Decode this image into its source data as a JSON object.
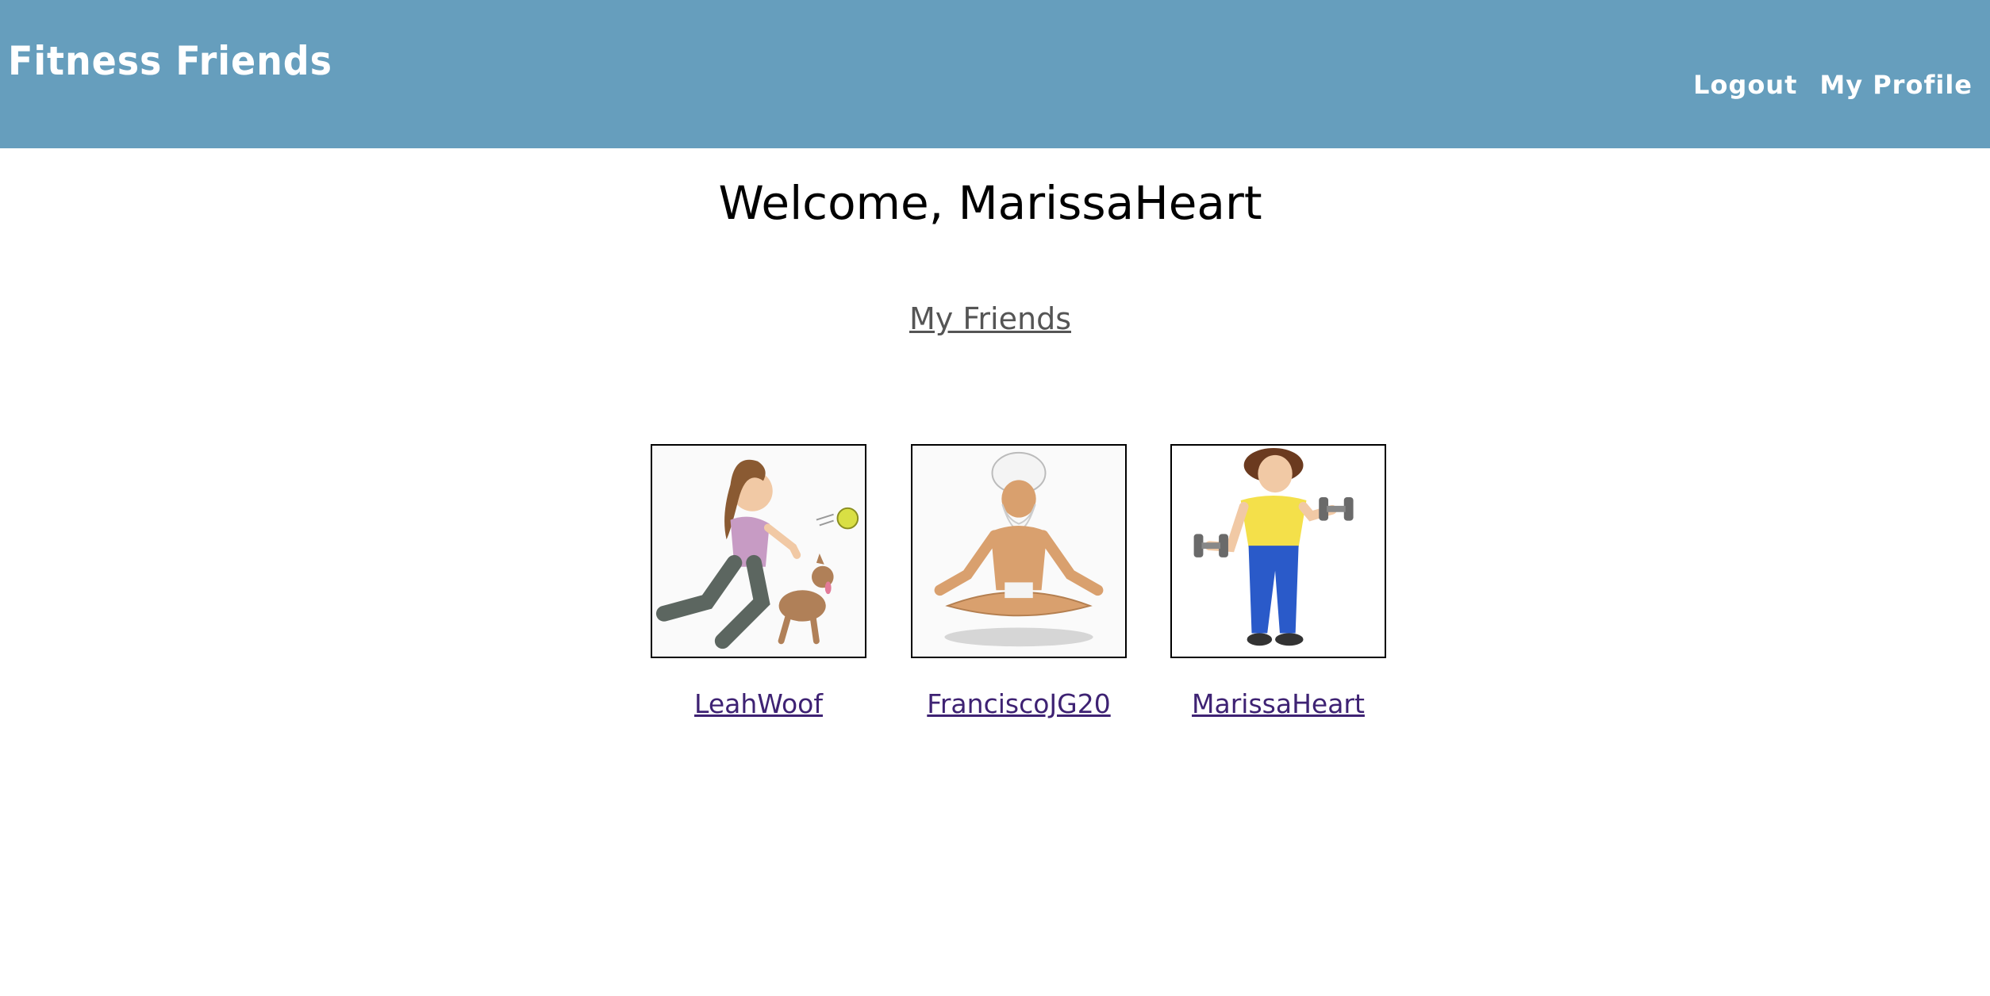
{
  "header": {
    "brand": "Fitness Friends",
    "nav": [
      {
        "label": "Logout"
      },
      {
        "label": "My Profile"
      }
    ]
  },
  "main": {
    "welcome": "Welcome, MarissaHeart",
    "friends_heading": "My Friends",
    "friends": [
      {
        "name": "LeahWoof",
        "photo": "woman-playing-with-dog-illustration"
      },
      {
        "name": "FranciscoJG20",
        "photo": "meditating-man-illustration"
      },
      {
        "name": "MarissaHeart",
        "photo": "woman-lifting-dumbbells-illustration"
      }
    ]
  },
  "colors": {
    "header_bg": "#669ebd",
    "link_visited": "#3e2273",
    "heading_link": "#555555"
  }
}
